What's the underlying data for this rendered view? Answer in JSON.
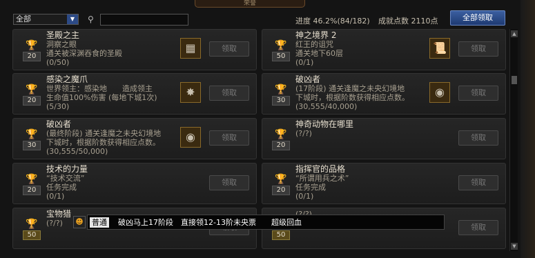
{
  "window": {
    "title": "荣誉"
  },
  "toolbar": {
    "filter_value": "全部",
    "search_placeholder": ""
  },
  "status": {
    "progress": "进度 46.2%(84/182)",
    "points": "成就点数 2110点"
  },
  "claim_all_label": "全部领取",
  "claim_label": "领取",
  "achievements": [
    {
      "points": "20",
      "title": "圣殿之主",
      "lines": [
        "洞察之眼",
        "通关被深渊吞食的圣殿",
        "(0/50)"
      ],
      "reward": true,
      "reward_icon": "treasure-map-icon"
    },
    {
      "points": "50",
      "title": "神之境界 2",
      "lines": [
        "红王的诅咒",
        "通关地下60层",
        "(0/1)"
      ],
      "reward": true,
      "reward_icon": "scroll-icon"
    },
    {
      "points": "20",
      "title": "感染之魔爪",
      "lines": [
        "世界领主：感染地　　造成领主",
        "生命值100%伤害 (每地下城1次)",
        "(5/30)"
      ],
      "reward": true,
      "reward_icon": "sparkle-icon"
    },
    {
      "points": "30",
      "title": "破凶者",
      "lines": [
        "(17阶段) 通关逢魔之未央幻境地",
        "下城时，根据阶数获得相应点数。",
        "(30,555/40,000)"
      ],
      "reward": true,
      "reward_icon": "emblem-icon"
    },
    {
      "points": "30",
      "title": "破凶者",
      "lines": [
        "(最终阶段) 通关逢魔之未央幻境地",
        "下城时，根据阶数获得相应点数。",
        "(30,555/50,000)"
      ],
      "reward": true,
      "reward_icon": "emblem-icon"
    },
    {
      "points": "20",
      "title": "神奇动物在哪里",
      "lines": [
        "(?/?)"
      ],
      "reward": false
    },
    {
      "points": "20",
      "title": "技术的力量",
      "lines": [
        "“技术交流”",
        "任务完成",
        "(0/1)"
      ],
      "reward": false
    },
    {
      "points": "20",
      "title": "指挥官的品格",
      "lines": [
        "“所谓用兵之术”",
        "任务完成",
        "(0/1)"
      ],
      "reward": false
    },
    {
      "points": "50",
      "title": "宝物猎",
      "lines": [
        "(?/?)"
      ],
      "reward": false,
      "gold": true
    },
    {
      "points": "50",
      "title": "",
      "lines": [
        "(?/?)"
      ],
      "reward": false,
      "gold": true
    }
  ],
  "chat": {
    "channel": "普通",
    "message": "破凶马上17阶段　直接领12-13阶未央票　　超级回血"
  }
}
